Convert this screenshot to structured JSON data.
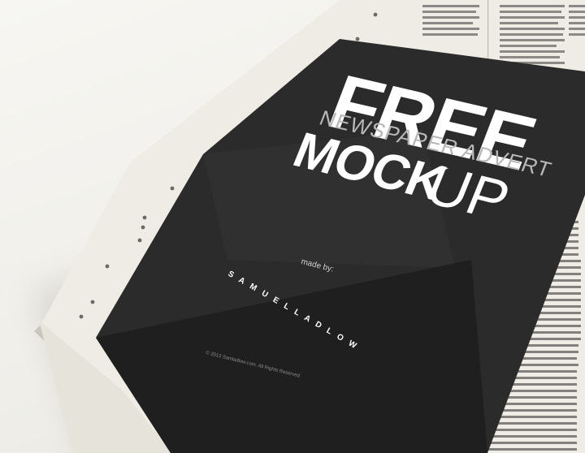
{
  "ad": {
    "headline_1": "FREE",
    "subhead": "NEWSPAPER ADVERT",
    "headline_2a": "MOCK",
    "headline_2b": "UP",
    "made_by": "made by:",
    "author": "S A M U E L   L A D L O W",
    "copyright": "© 2013 Samladlow.com. All Rights Reserved."
  },
  "colors": {
    "background": "#f2f1ec",
    "newspaper": "#eeece4",
    "ad_panel": "#2b2b2b",
    "ad_band": "#1f1f1f",
    "text_white": "#ffffff",
    "text_grey": "#9a9a9a"
  }
}
